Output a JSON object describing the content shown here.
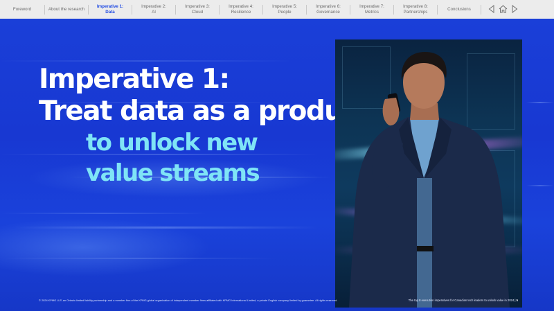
{
  "nav": {
    "items": [
      {
        "line1": "Foreword",
        "line2": ""
      },
      {
        "line1": "About the research",
        "line2": ""
      },
      {
        "line1": "Imperative 1:",
        "line2": "Data"
      },
      {
        "line1": "Imperative 2:",
        "line2": "AI"
      },
      {
        "line1": "Imperative 3:",
        "line2": "Cloud"
      },
      {
        "line1": "Imperative 4:",
        "line2": "Resilience"
      },
      {
        "line1": "Imperative 5:",
        "line2": "People"
      },
      {
        "line1": "Imperative 6:",
        "line2": "Governance"
      },
      {
        "line1": "Imperative 7:",
        "line2": "Metrics"
      },
      {
        "line1": "Imperative 8:",
        "line2": "Partnerships"
      },
      {
        "line1": "Conclusions",
        "line2": ""
      }
    ],
    "active_index": 2,
    "icons": {
      "prev": "triangle-left-icon",
      "home": "home-icon",
      "next": "triangle-right-icon"
    }
  },
  "headline": {
    "line1": "Imperative 1:",
    "line2": "Treat data as a product",
    "line3": "to unlock new",
    "line4": "value streams"
  },
  "footer": {
    "copyright": "© 2024 KPMG LLP, an Ontario limited liability partnership and a member firm of the KPMG global organization of independent member firms affiliated with KPMG International Limited, a private English company limited by guarantee. All rights reserved.",
    "doc_title": "The top 8 execution imperatives for Canadian tech leaders to unlock value in 2024",
    "page_sep": "|",
    "page_number": "5"
  },
  "colors": {
    "background": "#1a3fd6",
    "headline_white": "#ffffff",
    "headline_accent": "#7fe4f6",
    "nav_active": "#1e49e2"
  }
}
